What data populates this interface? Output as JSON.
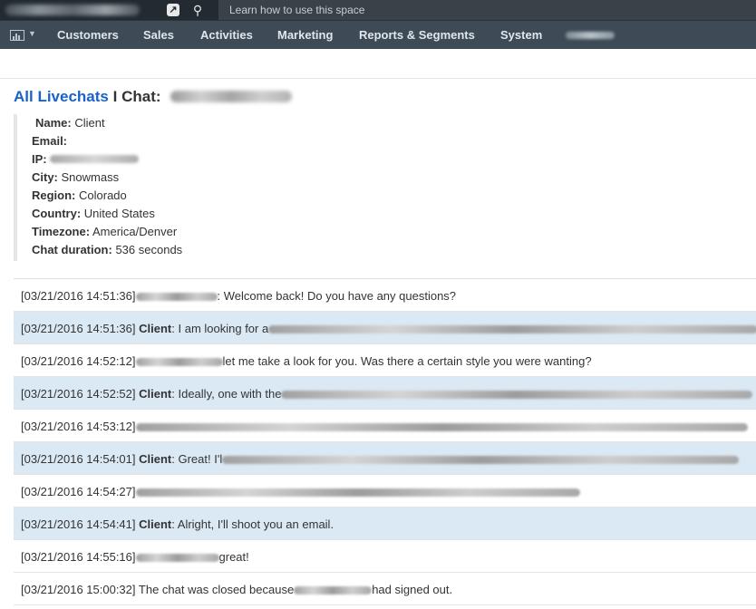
{
  "topbar": {
    "learn_text": "Learn how to use this space"
  },
  "nav": {
    "items": [
      "Customers",
      "Sales",
      "Activities",
      "Marketing",
      "Reports & Segments",
      "System"
    ]
  },
  "header": {
    "link_text": "All Livechats",
    "separator": "I",
    "chat_label": "Chat:"
  },
  "info": {
    "name_label": "Name:",
    "name_value": "Client",
    "email_label": "Email:",
    "ip_label": "IP:",
    "city_label": "City:",
    "city_value": "Snowmass",
    "region_label": "Region:",
    "region_value": "Colorado",
    "country_label": "Country:",
    "country_value": "United States",
    "timezone_label": "Timezone:",
    "timezone_value": "America/Denver",
    "duration_label": "Chat duration:",
    "duration_value": "536 seconds"
  },
  "messages": [
    {
      "ts": "[03/21/2016 14:51:36]",
      "sender": "",
      "text": ": Welcome back! Do you have any questions?"
    },
    {
      "ts": "[03/21/2016 14:51:36]",
      "sender": "Client",
      "text": ": I am looking for a"
    },
    {
      "ts": "[03/21/2016 14:52:12]",
      "sender": "",
      "text": "let me take a look for you. Was there a certain style you were wanting?"
    },
    {
      "ts": "[03/21/2016 14:52:52]",
      "sender": "Client",
      "text": ": Ideally, one with the"
    },
    {
      "ts": "[03/21/2016 14:53:12]",
      "sender": "",
      "text": ""
    },
    {
      "ts": "[03/21/2016 14:54:01]",
      "sender": "Client",
      "text": ": Great! I'l"
    },
    {
      "ts": "[03/21/2016 14:54:27]",
      "sender": "",
      "text": ""
    },
    {
      "ts": "[03/21/2016 14:54:41]",
      "sender": "Client",
      "text": ": Alright, I'll shoot you an email."
    },
    {
      "ts": "[03/21/2016 14:55:16]",
      "sender": "",
      "text": "great!"
    },
    {
      "ts": "[03/21/2016 15:00:32]",
      "sender": "",
      "text": "The chat was closed because"
    },
    {
      "ts_extra": "had signed out."
    }
  ],
  "colors": {
    "topbar": "#232a31",
    "navbar": "#3e4a55",
    "link": "#1a63c6",
    "client_row": "#dbe9f5"
  }
}
